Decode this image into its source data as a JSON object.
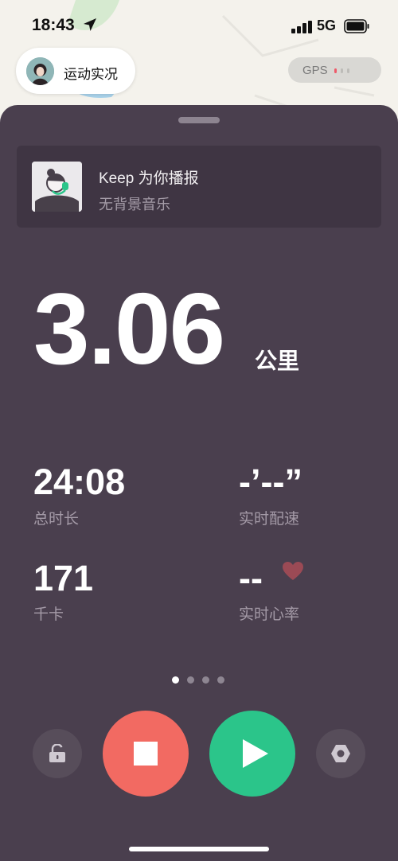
{
  "status_bar": {
    "time": "18:43",
    "network": "5G"
  },
  "header": {
    "live_pill_label": "运动实况",
    "gps_label": "GPS"
  },
  "audio_card": {
    "title": "Keep 为你播报",
    "subtitle": "无背景音乐"
  },
  "distance": {
    "value": "3.06",
    "unit": "公里"
  },
  "metrics": [
    {
      "value": "24:08",
      "label": "总时长"
    },
    {
      "value": "-’--”",
      "label": "实时配速"
    },
    {
      "value": "171",
      "label": "千卡"
    },
    {
      "value": "--",
      "label": "实时心率"
    }
  ],
  "pager": {
    "active_index": 0,
    "count": 4
  },
  "colors": {
    "sheet": "#4a3f4e",
    "stop": "#f26a62",
    "play": "#2bc58a",
    "heart": "#9b4a55"
  },
  "icons": [
    "location-arrow-icon",
    "signal-icon",
    "battery-icon",
    "unlock-icon",
    "stop-icon",
    "play-icon",
    "settings-icon",
    "heart-icon"
  ]
}
